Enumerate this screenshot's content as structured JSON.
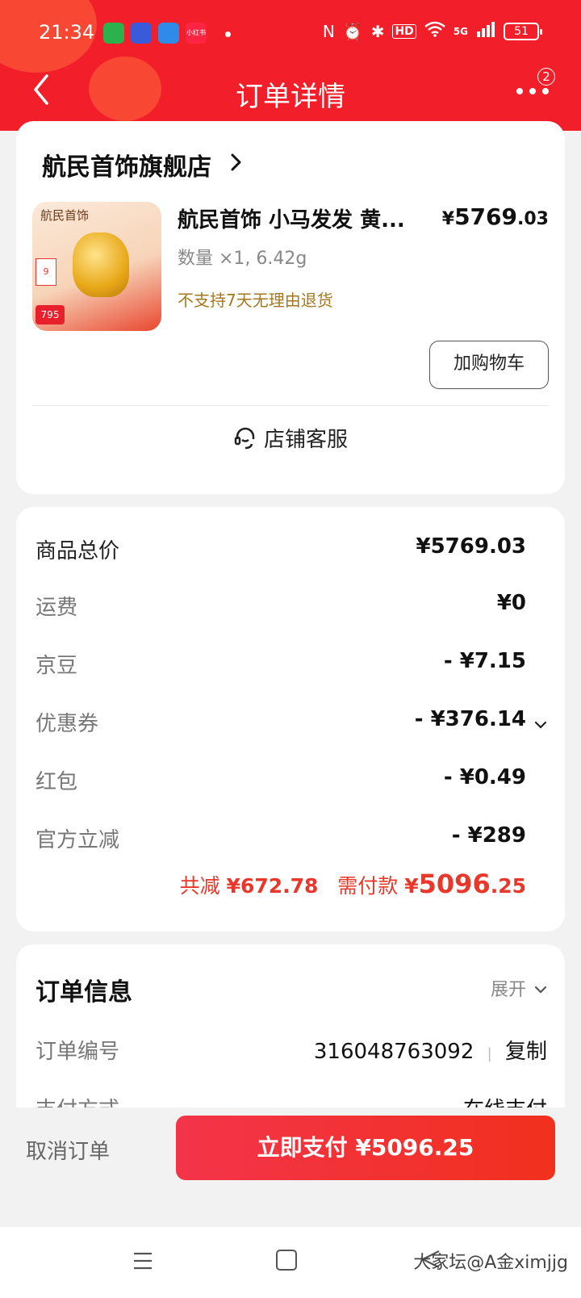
{
  "status_bar": {
    "time": "21:34",
    "app_icons": [
      "",
      "",
      "",
      "小红书"
    ],
    "signal_label": "5G",
    "hd_label": "HD",
    "battery": "51"
  },
  "header": {
    "title": "订单详情",
    "more_badge": "2"
  },
  "store": {
    "name": "航民首饰旗舰店",
    "product": {
      "thumb_brand": "航民首饰",
      "thumb_price": "795",
      "name": "航民首饰 小马发发 黄...",
      "price_currency": "¥",
      "price_int": "5769",
      "price_dec": ".03",
      "qty_spec": "数量 ×1, 6.42g",
      "notice": "不支持7天无理由退货"
    },
    "add_to_cart": "加购物车",
    "customer_service": "店铺客服"
  },
  "price_summary": {
    "rows": [
      {
        "label": "商品总价",
        "value": "¥5769.03"
      },
      {
        "label": "运费",
        "value": "¥0"
      },
      {
        "label": "京豆",
        "value": "- ¥7.15"
      },
      {
        "label": "优惠券",
        "value": "- ¥376.14"
      },
      {
        "label": "红包",
        "value": "- ¥0.49"
      },
      {
        "label": "官方立减",
        "value": "- ¥289"
      }
    ],
    "total_discount_label": "共减",
    "total_discount_value": "¥672.78",
    "payable_label": "需付款",
    "payable_currency": "¥",
    "payable_int": "5096",
    "payable_dec": ".25"
  },
  "order_info": {
    "title": "订单信息",
    "expand": "展开",
    "rows": [
      {
        "label": "订单编号",
        "value": "316048763092"
      },
      {
        "label": "支付方式",
        "value": "在线支付"
      }
    ],
    "copy": "复制"
  },
  "actions": {
    "cancel": "取消订单",
    "pay": "立即支付 ¥5096.25"
  },
  "watermark": "大家坛@A金ximjjg",
  "colors": {
    "brand_red": "#f21f2a",
    "price_red": "#e8382b",
    "notice_gold": "#a5781f"
  }
}
